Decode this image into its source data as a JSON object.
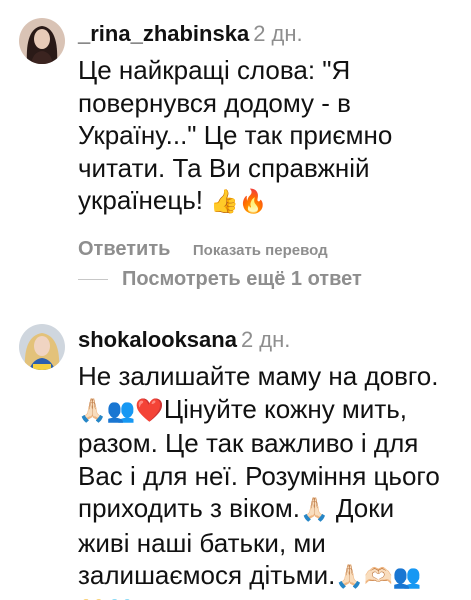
{
  "comments": [
    {
      "username": "_rina_zhabinska",
      "age": "2 дн.",
      "text": "Це найкращі слова: \"Я\nповернувся додому - в\nУкраїну...\" Це так приємно\nчитати. Та Ви справжній\nукраїнець! ",
      "emoji_tail": "👍🔥",
      "reply_label": "Ответить",
      "translate_label": "Показать перевод",
      "avatar_icon": "avatar-woman-dark-hair"
    },
    {
      "username": "shokalooksana",
      "age": "2 дн.",
      "text_parts": [
        "Не залишайте маму на довго.\n",
        "🙏🏻👥❤️",
        "Цінуйте кожну мить,\nразом. Це так важливо і для\nВас і для неї. Розуміння цього\nприходить з віком.",
        "🙏🏻",
        " Доки\nживі наші батьки, ми\nзалишаємося дітьми.",
        "🙏🏻🫶🏻👥\n💛🩵"
      ],
      "avatar_icon": "avatar-woman-blonde"
    }
  ],
  "more_replies_label": "Посмотреть ещё 1 ответ",
  "colors": {
    "primary_text": "#111111",
    "secondary_text": "#8e8e8e",
    "divider": "#c7c7c7"
  }
}
